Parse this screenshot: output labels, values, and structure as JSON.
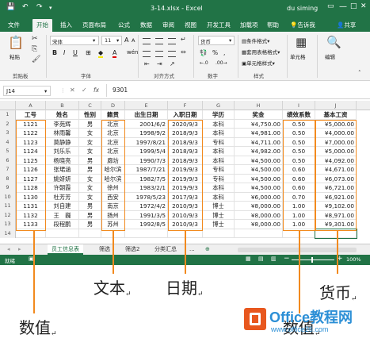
{
  "titlebar": {
    "title": "3-14.xlsx - Excel",
    "user": "du siming",
    "qa_save": "💾",
    "qa_undo": "↶",
    "qa_redo": "↷",
    "win_min": "—",
    "win_max": "□",
    "win_close": "✕"
  },
  "tabs": [
    "文件",
    "开始",
    "插入",
    "页面布局",
    "公式",
    "数据",
    "审阅",
    "视图",
    "开发工具",
    "加载项",
    "帮助",
    "告诉我",
    "共享"
  ],
  "ribbon": {
    "paste": "粘贴",
    "clipboard": "剪贴板",
    "font_name": "宋体",
    "font_size": "11",
    "bold": "B",
    "italic": "I",
    "underline": "U",
    "font_group": "字体",
    "align_group": "对齐方式",
    "number_format": "货币",
    "number_group": "数字",
    "cond_format": "条件格式",
    "table_format": "套用表格格式",
    "cell_style": "单元格样式",
    "style_group": "样式",
    "cells": "单元格",
    "editing": "编辑"
  },
  "formula_bar": {
    "name_box": "J14",
    "fx": "fx",
    "value": "9301"
  },
  "columns": [
    "A",
    "B",
    "C",
    "D",
    "E",
    "F",
    "G",
    "H",
    "I",
    "J"
  ],
  "table": {
    "headers": [
      "工号",
      "姓名",
      "性别",
      "籍贯",
      "出生日期",
      "入职日期",
      "学历",
      "奖金",
      "绩效系数",
      "基本工资"
    ],
    "rows": [
      [
        "1121",
        "李苑辉",
        "男",
        "北京",
        "2001/6/2",
        "2020/9/3",
        "本科",
        "¥4,750.00",
        "0.50",
        "¥5,000.00"
      ],
      [
        "1122",
        "林雨馨",
        "女",
        "北京",
        "1998/9/2",
        "2018/9/3",
        "本科",
        "¥4,981.00",
        "0.50",
        "¥4,000.00"
      ],
      [
        "1123",
        "莫静静",
        "女",
        "北京",
        "1997/8/21",
        "2018/9/3",
        "专科",
        "¥4,711.00",
        "0.50",
        "¥7,000.00"
      ],
      [
        "1124",
        "刘乐乐",
        "女",
        "北京",
        "1999/5/4",
        "2018/9/3",
        "本科",
        "¥4,982.00",
        "0.50",
        "¥5,000.00"
      ],
      [
        "1125",
        "杨晓亮",
        "男",
        "廊坊",
        "1990/7/3",
        "2018/9/3",
        "本科",
        "¥4,500.00",
        "0.50",
        "¥4,092.00"
      ],
      [
        "1126",
        "张珺涵",
        "男",
        "哈尔滨",
        "1987/7/21",
        "2019/9/3",
        "专科",
        "¥4,500.00",
        "0.60",
        "¥4,671.00"
      ],
      [
        "1127",
        "姚妍妍",
        "女",
        "哈尔滨",
        "1982/7/5",
        "2019/9/3",
        "专科",
        "¥4,500.00",
        "0.60",
        "¥6,073.00"
      ],
      [
        "1128",
        "许朝霞",
        "女",
        "徐州",
        "1983/2/1",
        "2019/9/3",
        "本科",
        "¥4,500.00",
        "0.60",
        "¥6,721.00"
      ],
      [
        "1130",
        "杜芳芳",
        "女",
        "西安",
        "1978/5/23",
        "2017/9/3",
        "本科",
        "¥6,000.00",
        "0.70",
        "¥6,921.00"
      ],
      [
        "1131",
        "刘自建",
        "男",
        "南京",
        "1972/4/2",
        "2010/9/3",
        "博士",
        "¥8,000.00",
        "1.00",
        "¥9,102.00"
      ],
      [
        "1132",
        "王　巍",
        "男",
        "扬州",
        "1991/3/5",
        "2010/9/3",
        "博士",
        "¥8,000.00",
        "1.00",
        "¥8,971.00"
      ],
      [
        "1133",
        "段程鹏",
        "男",
        "苏州",
        "1992/8/5",
        "2010/9/3",
        "博士",
        "¥8,000.00",
        "1.00",
        "¥9,301.00"
      ]
    ]
  },
  "sheets": [
    "员工信息表",
    "筛选",
    "筛选2",
    "分类汇总",
    "...",
    "⊕"
  ],
  "status": {
    "ready": "就绪",
    "zoom": "100%"
  },
  "annotations": {
    "numeric": "数值",
    "text": "文本",
    "date": "日期",
    "numeric2": "数值",
    "currency": "货币",
    "mark": "↵"
  },
  "watermark": {
    "title": "Office教程网",
    "url": "www.office26.com"
  },
  "colors": {
    "excel_green": "#217346",
    "annotation_orange": "#f28a1e"
  }
}
